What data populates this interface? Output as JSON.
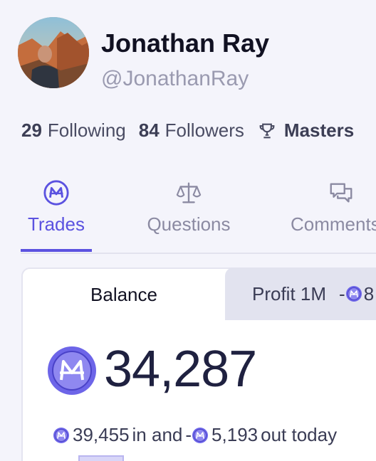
{
  "profile": {
    "display_name": "Jonathan Ray",
    "username": "@JonathanRay"
  },
  "stats": {
    "following_count": "29",
    "following_label": "Following",
    "followers_count": "84",
    "followers_label": "Followers",
    "league_label": "Masters"
  },
  "tabs": [
    {
      "label": "Trades",
      "icon": "mana-coin-icon",
      "active": true
    },
    {
      "label": "Questions",
      "icon": "scale-icon",
      "active": false
    },
    {
      "label": "Comments",
      "icon": "chat-bubbles-icon",
      "active": false
    }
  ],
  "balance_card": {
    "tabs": {
      "balance_label": "Balance",
      "profit_label": "Profit 1M",
      "profit_sign": "-",
      "profit_value": "8"
    },
    "balance_value": "34,287",
    "today": {
      "in_value": "39,455",
      "in_text": "in and",
      "out_sign": "-",
      "out_value": "5,193",
      "out_text": "out today"
    }
  },
  "colors": {
    "accent": "#5b52e0",
    "background": "#f4f4fb",
    "mana_coin": "#6d65e8"
  }
}
